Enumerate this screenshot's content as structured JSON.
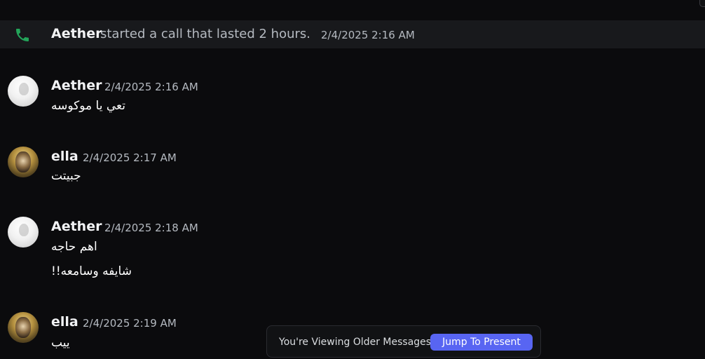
{
  "call": {
    "author": "Aether",
    "text": "started a call that lasted 2 hours.",
    "time": "2/4/2025 2:16 AM",
    "icon": "phone-icon",
    "icon_color": "#23a55a"
  },
  "messages": [
    {
      "author": "Aether",
      "time": "2/4/2025 2:16 AM",
      "lines": [
        "تعي يا موكوسه"
      ],
      "avatar": "avatar-aether"
    },
    {
      "author": "ella",
      "time": "2/4/2025 2:17 AM",
      "lines": [
        "جبيتت"
      ],
      "avatar": "avatar-ella"
    },
    {
      "author": "Aether",
      "time": "2/4/2025 2:18 AM",
      "lines": [
        "اهم حاجه",
        "شايفه وسامعه!!"
      ],
      "avatar": "avatar-aether"
    },
    {
      "author": "ella",
      "time": "2/4/2025 2:19 AM",
      "lines": [
        "ييب"
      ],
      "avatar": "avatar-ella"
    }
  ],
  "older_messages": {
    "notice": "You're Viewing Older Messages",
    "jump_label": "Jump To Present",
    "accent": "#5865f2"
  }
}
